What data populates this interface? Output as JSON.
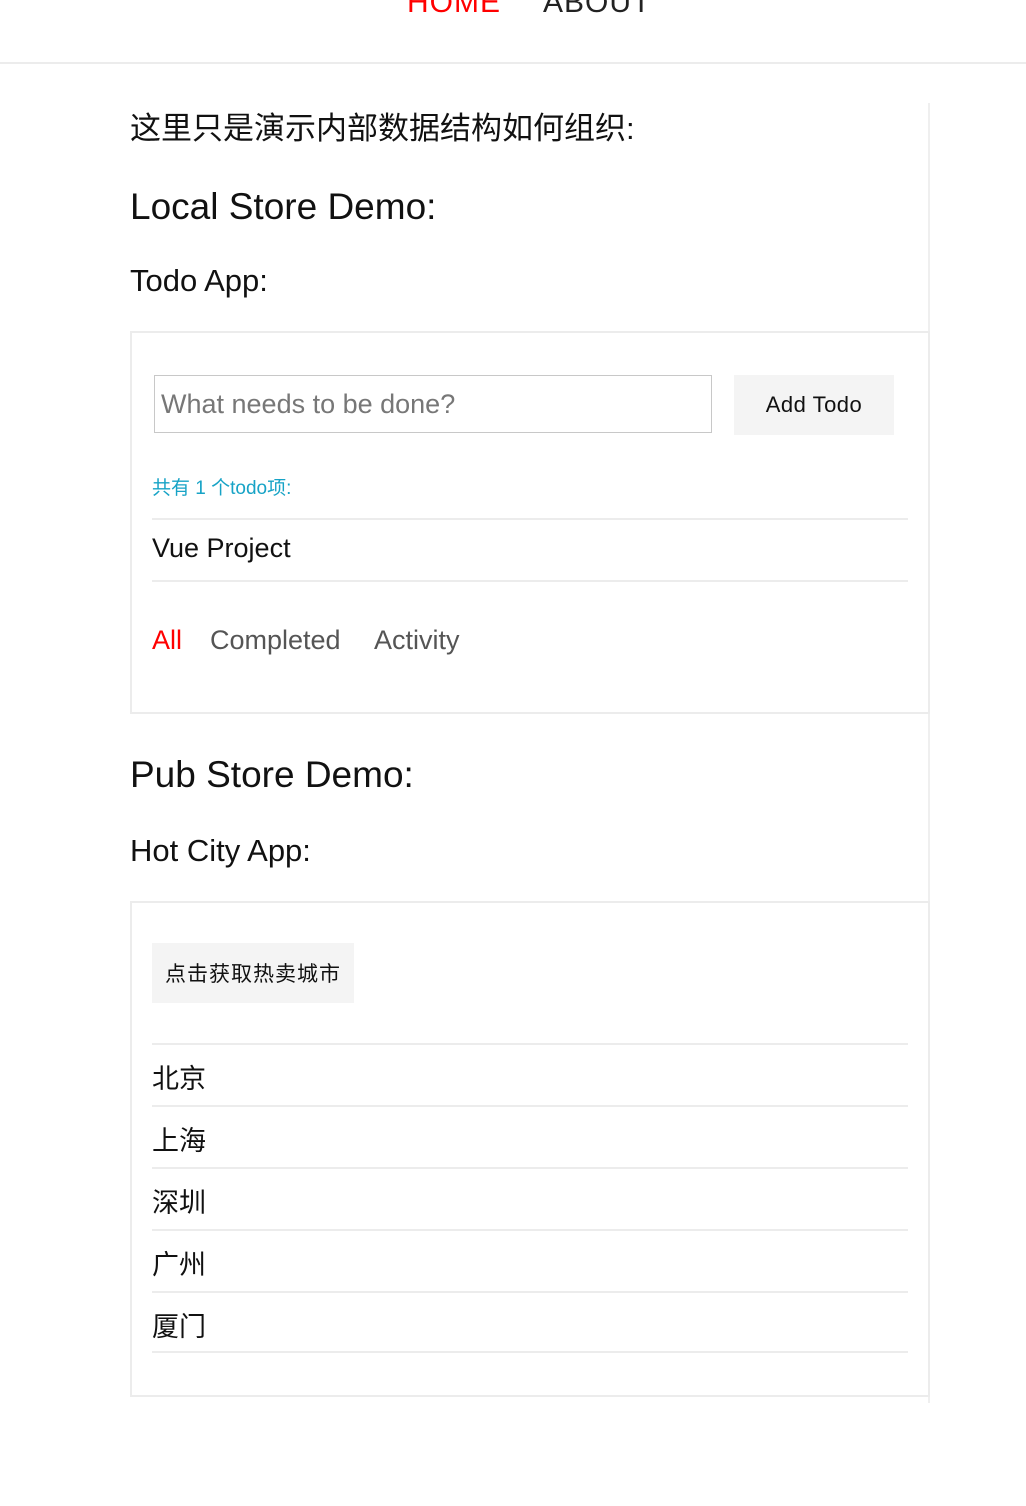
{
  "nav": {
    "home_label": "HOME",
    "about_label": "ABOUT",
    "active_color": "#ff0000"
  },
  "intro_text": "这里只是演示内部数据结构如何组织:",
  "local_demo": {
    "heading": "Local Store Demo:",
    "app_title": "Todo App:",
    "input_placeholder": "What needs to be done?",
    "input_value": "",
    "add_button_label": "Add Todo",
    "count_text": "共有 1 个todo项:",
    "todos": [
      "Vue Project"
    ],
    "filters": [
      {
        "label": "All",
        "active": true
      },
      {
        "label": "Completed",
        "active": false
      },
      {
        "label": "Activity",
        "active": false
      }
    ]
  },
  "pub_demo": {
    "heading": "Pub Store Demo:",
    "app_title": "Hot City App:",
    "fetch_button_label": "点击获取热卖城市",
    "cities": [
      "北京",
      "上海",
      "深圳",
      "广州",
      "厦门"
    ]
  }
}
